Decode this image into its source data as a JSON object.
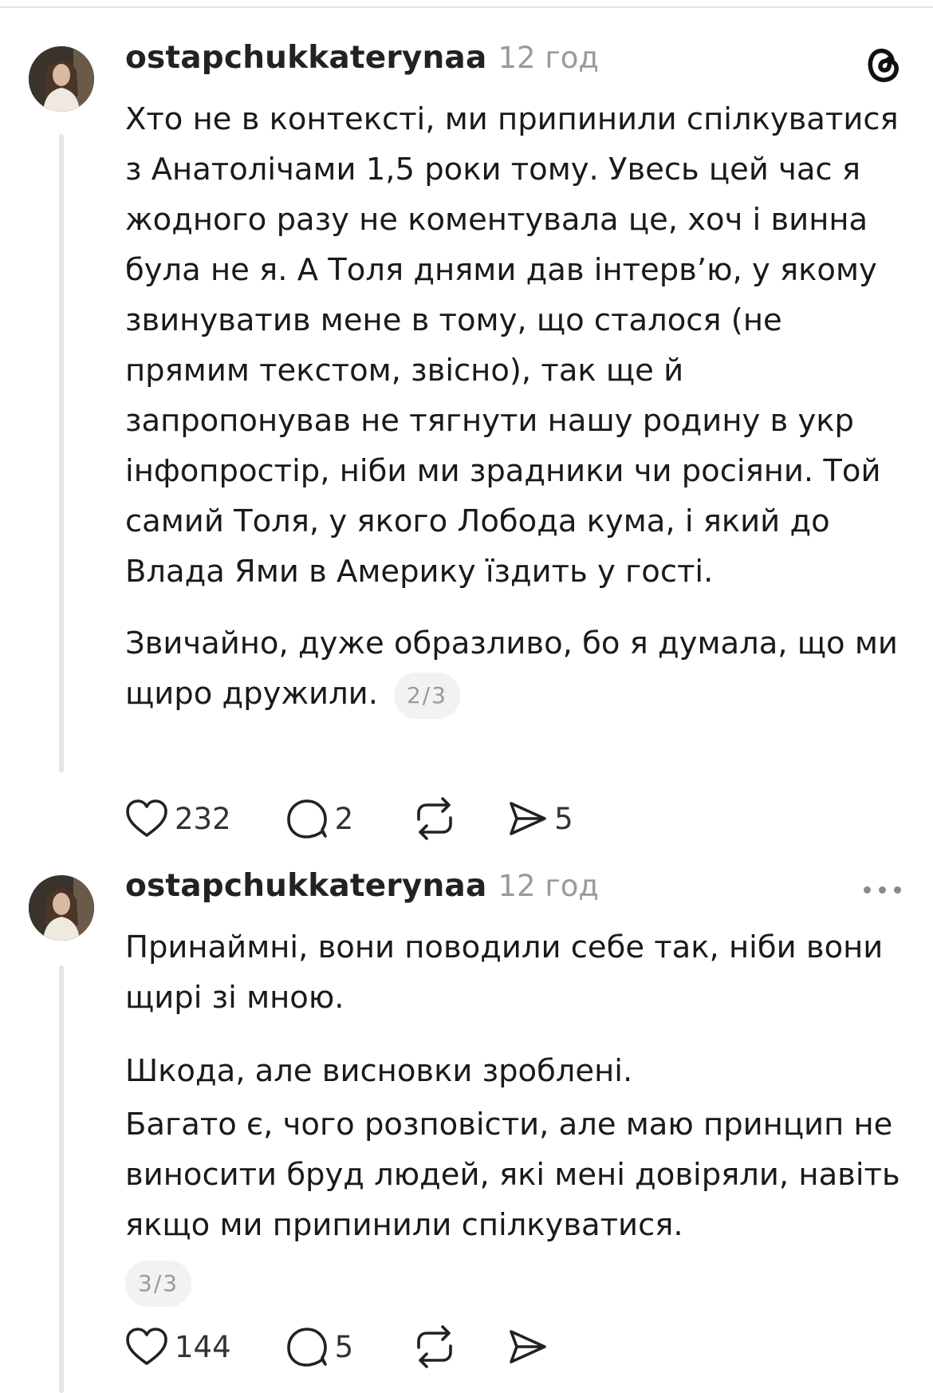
{
  "posts": [
    {
      "username": "ostapchukkaterynaa",
      "time": "12 год",
      "paragraphs": [
        "Хто не в контексті, ми припинили спілкуватися з Анатолічами 1,5 роки тому. Увесь цей час я жодного разу не коментувала це, хоч і винна була не я. А Толя днями дав інтерв’ю, у якому звинуватив мене в тому, що сталося (не прямим текстом, звісно), так ще й запропонував не тягнути нашу родину в укр інфопростір, ніби ми зрадники чи росіяни. Той самий Толя, у якого Лобода кума, і який до Влада Ями в Америку їздить у гості.",
        "Звичайно, дуже образливо, бо я думала, що ми щиро дружили."
      ],
      "pager": "2/3",
      "likes": "232",
      "comments": "2",
      "shares": "5"
    },
    {
      "username": "ostapchukkaterynaa",
      "time": "12 год",
      "paragraphs": [
        "Принаймні, вони поводили себе так, ніби вони щирі зі мною.",
        "Шкода, але висновки зроблені.",
        "Багато є, чого розповісти, але маю принцип не виносити бруд людей, які мені довіряли, навіть якщо ми припинили спілкуватися."
      ],
      "pager": "3/3",
      "likes": "144",
      "comments": "5"
    }
  ],
  "icons": {
    "logo": "threads-logo-icon",
    "more": "more-options-icon",
    "like": "heart-icon",
    "comment": "comment-bubble-icon",
    "repost": "repost-icon",
    "share": "send-icon"
  }
}
